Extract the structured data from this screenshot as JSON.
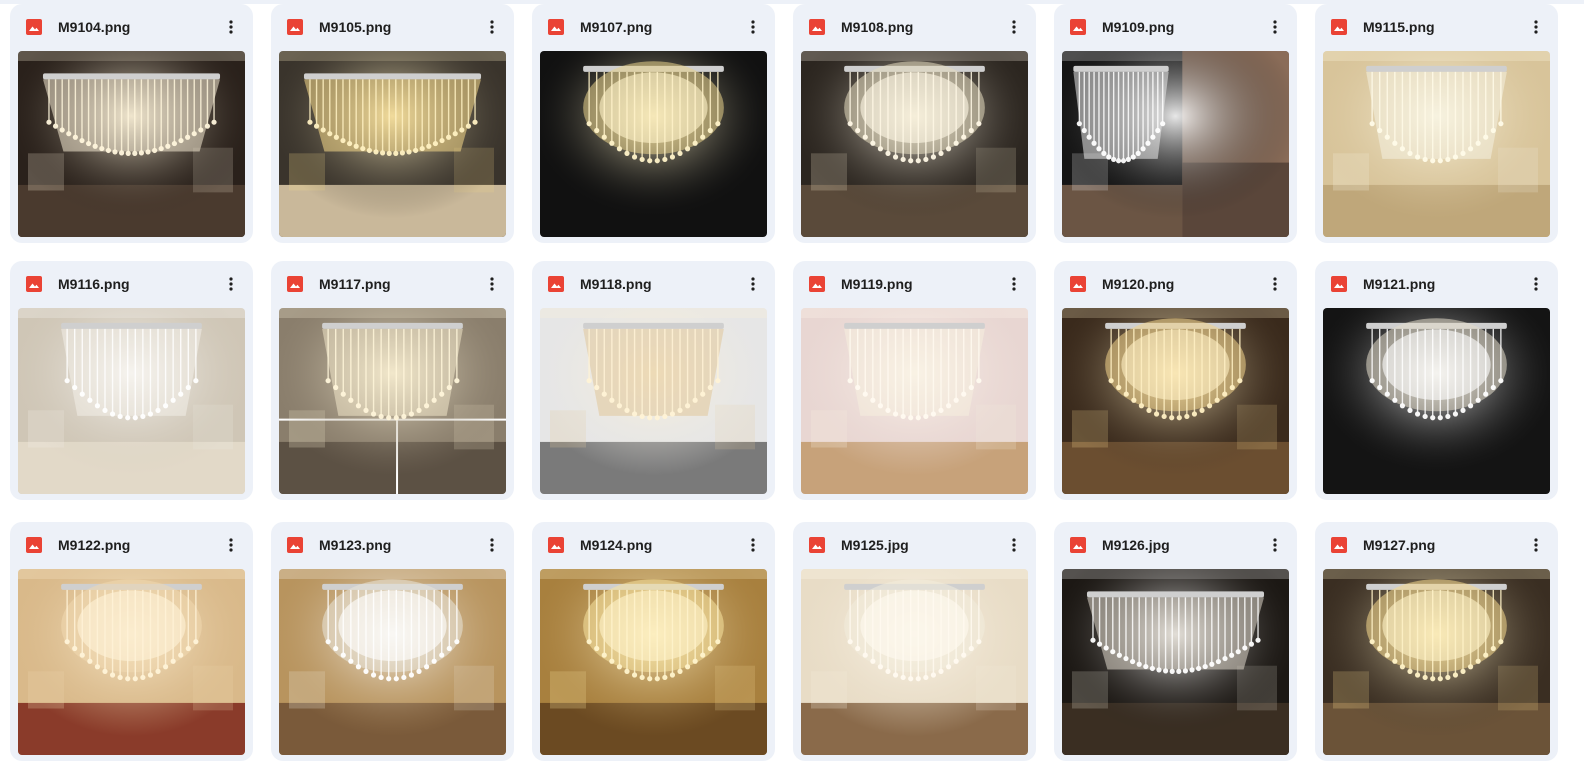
{
  "colors": {
    "card_bg": "#edf1f8",
    "file_icon": "#ea4335",
    "text": "#1f1f1f"
  },
  "files": [
    {
      "name": "M9104.png",
      "icon": "image-file-icon",
      "scene": "dark-room-linear-chandelier",
      "palette": {
        "bg": "#2a211b",
        "floor": "#4a3a2e",
        "light": "#f2e8d0",
        "glow": "#fff6dc"
      }
    },
    {
      "name": "M9105.png",
      "icon": "image-file-icon",
      "scene": "living-room-linear-chandelier",
      "palette": {
        "bg": "#3a342c",
        "floor": "#c9b89a",
        "light": "#f5d889",
        "glow": "#fff1c2"
      }
    },
    {
      "name": "M9107.png",
      "icon": "image-file-icon",
      "scene": "black-background-round-crystal",
      "palette": {
        "bg": "#111111",
        "floor": "#111111",
        "light": "#e8d18a",
        "glow": "#fff3c9"
      }
    },
    {
      "name": "M9108.png",
      "icon": "image-file-icon",
      "scene": "dark-room-round-flush-mount",
      "palette": {
        "bg": "#2c2620",
        "floor": "#5a4a3a",
        "light": "#e6dcc0",
        "glow": "#fff8e6"
      }
    },
    {
      "name": "M9109.png",
      "icon": "image-file-icon",
      "scene": "split-black-and-bedroom",
      "palette": {
        "bg": "#151515",
        "floor": "#6b5544",
        "light": "#e9e9e9",
        "glow": "#ffffff"
      }
    },
    {
      "name": "M9115.png",
      "icon": "image-file-icon",
      "scene": "warm-room-square-crystal",
      "palette": {
        "bg": "#d8c49a",
        "floor": "#bfa77a",
        "light": "#f4f0e0",
        "glow": "#fffbe8"
      }
    },
    {
      "name": "M9116.png",
      "icon": "image-file-icon",
      "scene": "bright-ceiling-square-crystal",
      "palette": {
        "bg": "#cfc6b6",
        "floor": "#e2d9c8",
        "light": "#f2efe8",
        "glow": "#ffffff"
      }
    },
    {
      "name": "M9117.png",
      "icon": "image-file-icon",
      "scene": "collage-square-crystal",
      "palette": {
        "bg": "#8a7e6c",
        "floor": "#5c5144",
        "light": "#f0e6c8",
        "glow": "#fff6da"
      }
    },
    {
      "name": "M9118.png",
      "icon": "image-file-icon",
      "scene": "white-room-tiered-square",
      "palette": {
        "bg": "#e6e6e6",
        "floor": "#7a7a7a",
        "light": "#e0c79a",
        "glow": "#fff3d6"
      }
    },
    {
      "name": "M9119.png",
      "icon": "image-file-icon",
      "scene": "pink-ceiling-square-crystal",
      "palette": {
        "bg": "#e8d6d2",
        "floor": "#c7a27a",
        "light": "#f6eede",
        "glow": "#fffaf0"
      }
    },
    {
      "name": "M9120.png",
      "icon": "image-file-icon",
      "scene": "brown-ceiling-ring-chandelier",
      "palette": {
        "bg": "#3a2a1c",
        "floor": "#6b4e30",
        "light": "#f2d38a",
        "glow": "#fff0c4"
      }
    },
    {
      "name": "M9121.png",
      "icon": "image-file-icon",
      "scene": "black-background-tiered-round",
      "palette": {
        "bg": "#141414",
        "floor": "#141414",
        "light": "#e3dccb",
        "glow": "#ffffff"
      }
    },
    {
      "name": "M9122.png",
      "icon": "image-file-icon",
      "scene": "bedroom-round-crystal",
      "palette": {
        "bg": "#d9b98a",
        "floor": "#8a3b2a",
        "light": "#f0d9b0",
        "glow": "#fff3d8"
      }
    },
    {
      "name": "M9123.png",
      "icon": "image-file-icon",
      "scene": "gold-ceiling-ring-pendants",
      "palette": {
        "bg": "#b8945e",
        "floor": "#7a5a3a",
        "light": "#eae6da",
        "glow": "#ffffff"
      }
    },
    {
      "name": "M9124.png",
      "icon": "image-file-icon",
      "scene": "gold-room-tiered-round",
      "palette": {
        "bg": "#a8803e",
        "floor": "#6b4a22",
        "light": "#f8e3a0",
        "glow": "#fff4cc"
      }
    },
    {
      "name": "M9125.jpg",
      "icon": "image-file-icon",
      "scene": "cream-ceiling-round-crystal",
      "palette": {
        "bg": "#e8dcc6",
        "floor": "#8a6a4a",
        "light": "#f3ecdc",
        "glow": "#fffaf0"
      }
    },
    {
      "name": "M9126.jpg",
      "icon": "image-file-icon",
      "scene": "dark-ceiling-rectangular-rain",
      "palette": {
        "bg": "#1c1814",
        "floor": "#3a2e22",
        "light": "#dcd6c8",
        "glow": "#ffffff"
      }
    },
    {
      "name": "M9127.png",
      "icon": "image-file-icon",
      "scene": "dark-room-cascade-crystal",
      "palette": {
        "bg": "#3a2e22",
        "floor": "#6b5338",
        "light": "#f6d98c",
        "glow": "#fff3c8"
      }
    }
  ]
}
